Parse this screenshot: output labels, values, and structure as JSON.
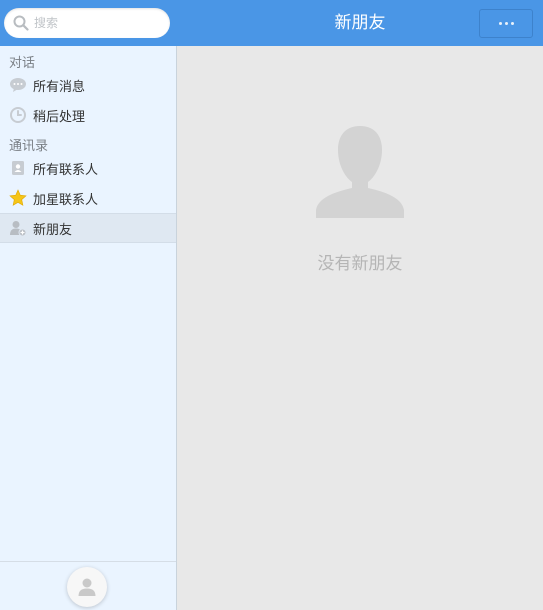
{
  "search": {
    "placeholder": "搜索"
  },
  "sidebar": {
    "sections": [
      {
        "label": "对话"
      },
      {
        "label": "通讯录"
      }
    ],
    "items": [
      {
        "label": "所有消息",
        "icon": "chat-bubble-icon"
      },
      {
        "label": "稍后处理",
        "icon": "clock-icon"
      },
      {
        "label": "所有联系人",
        "icon": "contacts-book-icon"
      },
      {
        "label": "加星联系人",
        "icon": "star-icon"
      },
      {
        "label": "新朋友",
        "icon": "new-friend-icon",
        "active": true
      }
    ]
  },
  "header": {
    "title": "新朋友",
    "more_icon": "more-dots-icon"
  },
  "main": {
    "empty_text": "没有新朋友",
    "empty_icon": "person-silhouette-icon"
  },
  "colors": {
    "accent": "#4a96e6",
    "sidebar_bg": "#eaf4ff",
    "content_bg": "#e8e8e8",
    "star": "#f5c518"
  }
}
